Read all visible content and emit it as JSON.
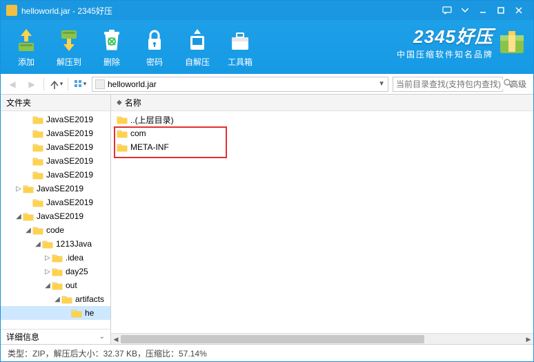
{
  "window": {
    "title": "helloworld.jar - 2345好压"
  },
  "toolbar": {
    "add": "添加",
    "extract": "解压到",
    "delete": "删除",
    "password": "密码",
    "selfextract": "自解压",
    "tools": "工具箱"
  },
  "brand": {
    "logo": "2345好压",
    "sub": "中国压缩软件知名品牌"
  },
  "nav": {
    "path": "helloworld.jar",
    "search_placeholder": "当前目录查找(支持包内查找)",
    "advanced": "高级"
  },
  "sidebar": {
    "header": "文件夹",
    "footer": "详细信息",
    "tree": [
      {
        "indent": 2,
        "exp": "",
        "label": "JavaSE2019"
      },
      {
        "indent": 2,
        "exp": "",
        "label": "JavaSE2019"
      },
      {
        "indent": 2,
        "exp": "",
        "label": "JavaSE2019"
      },
      {
        "indent": 2,
        "exp": "",
        "label": "JavaSE2019"
      },
      {
        "indent": 2,
        "exp": "",
        "label": "JavaSE2019"
      },
      {
        "indent": 1,
        "exp": "▷",
        "label": "JavaSE2019"
      },
      {
        "indent": 2,
        "exp": "",
        "label": "JavaSE2019"
      },
      {
        "indent": 1,
        "exp": "◢",
        "label": "JavaSE2019"
      },
      {
        "indent": 2,
        "exp": "◢",
        "label": "code"
      },
      {
        "indent": 3,
        "exp": "◢",
        "label": "1213Java"
      },
      {
        "indent": 4,
        "exp": "▷",
        "label": ".idea"
      },
      {
        "indent": 4,
        "exp": "▷",
        "label": "day25"
      },
      {
        "indent": 4,
        "exp": "◢",
        "label": "out"
      },
      {
        "indent": 5,
        "exp": "◢",
        "label": "artifacts"
      },
      {
        "indent": 6,
        "exp": "",
        "label": "he",
        "sel": true
      }
    ]
  },
  "main": {
    "column": "名称",
    "rows": [
      {
        "label": "..(上层目录)"
      },
      {
        "label": "com"
      },
      {
        "label": "META-INF"
      }
    ]
  },
  "status": "类型：ZIP，解压后大小：32.37 KB，压缩比：57.14%"
}
